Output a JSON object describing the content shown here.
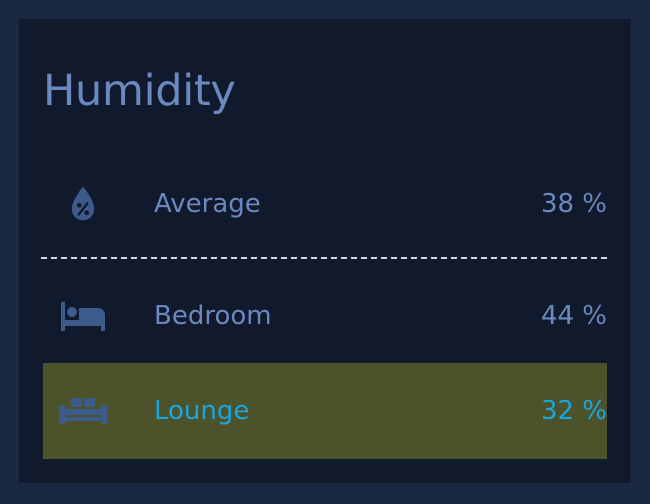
{
  "card": {
    "title": "Humidity"
  },
  "summary": {
    "label": "Average",
    "value": "38 %",
    "icon": "water-percent-icon"
  },
  "rooms": [
    {
      "label": "Bedroom",
      "value": "44 %",
      "icon": "bed-icon",
      "highlighted": false
    },
    {
      "label": "Lounge",
      "value": "32 %",
      "icon": "sofa-icon",
      "highlighted": true
    }
  ],
  "colors": {
    "frame": "#1a2842",
    "card_background": "#111a2c",
    "text": "#6b88bf",
    "icon": "#3d5a8c",
    "highlight_background": "#4c522a",
    "highlight_text": "#1ba6df",
    "divider": "#d4d8de"
  }
}
